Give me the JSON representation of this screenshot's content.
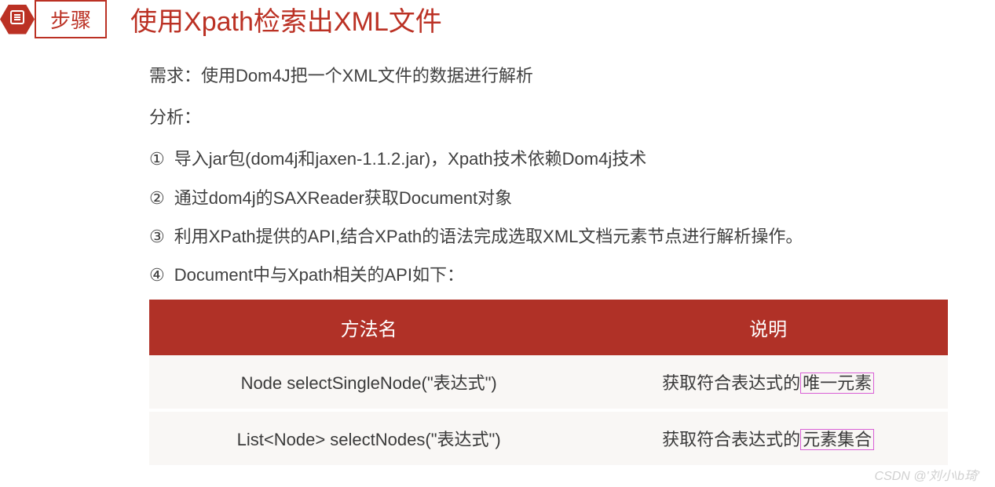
{
  "header": {
    "step_label": "步骤",
    "title": "使用Xpath检索出XML文件"
  },
  "content": {
    "req": "需求：使用Dom4J把一个XML文件的数据进行解析",
    "analysis_label": "分析：",
    "steps": {
      "s1": "导入jar包(dom4j和jaxen-1.1.2.jar)，Xpath技术依赖Dom4j技术",
      "s2": "通过dom4j的SAXReader获取Document对象",
      "s3": "利用XPath提供的API,结合XPath的语法完成选取XML文档元素节点进行解析操作。",
      "s4": "Document中与Xpath相关的API如下："
    },
    "circles": {
      "c1": "①",
      "c2": "②",
      "c3": "③",
      "c4": "④"
    }
  },
  "table": {
    "headers": {
      "method": "方法名",
      "desc": "说明"
    },
    "rows": {
      "r1": {
        "method": "Node selectSingleNode(\"表达式\")",
        "desc_prefix": "获取符合表达式的",
        "desc_hl": "唯一元素"
      },
      "r2": {
        "method": "List<Node> selectNodes(\"表达式\")",
        "desc_prefix": "获取符合表达式的",
        "desc_hl": "元素集合"
      }
    }
  },
  "watermark": "CSDN @'刘小\\b琦'"
}
